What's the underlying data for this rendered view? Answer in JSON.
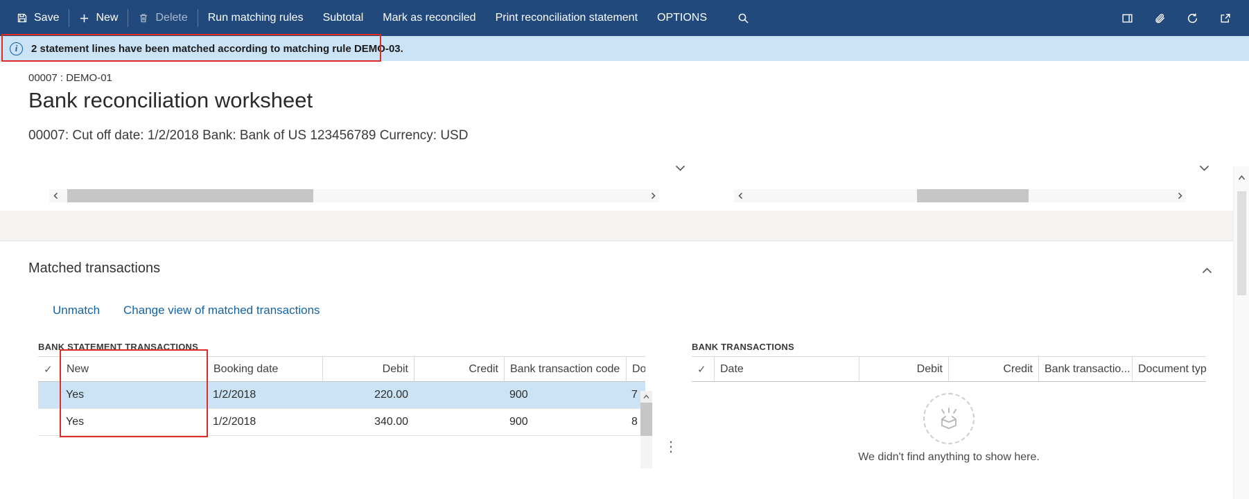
{
  "command_bar": {
    "items": [
      {
        "id": "save",
        "label": "Save"
      },
      {
        "id": "new",
        "label": "New"
      },
      {
        "id": "delete",
        "label": "Delete"
      },
      {
        "id": "run_matching_rules",
        "label": "Run matching rules"
      },
      {
        "id": "subtotal",
        "label": "Subtotal"
      },
      {
        "id": "mark_as_reconciled",
        "label": "Mark as reconciled"
      },
      {
        "id": "print_reconciliation_statement",
        "label": "Print reconciliation statement"
      },
      {
        "id": "options",
        "label": "OPTIONS"
      }
    ],
    "right_icons": [
      "side-panel-icon",
      "paperclip-icon",
      "refresh-icon",
      "popout-icon"
    ]
  },
  "message_bar": {
    "text": "2 statement lines have been matched according to matching rule DEMO-03."
  },
  "header": {
    "record_id": "00007 : DEMO-01",
    "title": "Bank reconciliation worksheet",
    "subtitle": "00007: Cut off date: 1/2/2018 Bank: Bank of US 123456789 Currency: USD"
  },
  "matched_section": {
    "title": "Matched transactions",
    "actions": {
      "unmatch": "Unmatch",
      "change_view": "Change view of matched transactions"
    },
    "left_table": {
      "caption": "BANK STATEMENT TRANSACTIONS",
      "columns": [
        "New",
        "Booking date",
        "Debit",
        "Credit",
        "Bank transaction code",
        "Docu"
      ],
      "rows": [
        {
          "selected": true,
          "new": "Yes",
          "booking_date": "1/2/2018",
          "debit": "220.00",
          "credit": "",
          "code": "900",
          "document": "7"
        },
        {
          "selected": false,
          "new": "Yes",
          "booking_date": "1/2/2018",
          "debit": "340.00",
          "credit": "",
          "code": "900",
          "document": "8"
        }
      ]
    },
    "right_table": {
      "caption": "BANK TRANSACTIONS",
      "columns": [
        "Date",
        "Debit",
        "Credit",
        "Bank transactio...",
        "Document type"
      ],
      "empty_state": {
        "text": "We didn't find anything to show here."
      }
    }
  },
  "icons": {
    "check": "✓",
    "info": "i",
    "ellipsis": "⋮"
  },
  "colors": {
    "command_bar_bg": "#21497c",
    "message_bar_bg": "#cbe3f6",
    "annotation_red": "#de2b23",
    "selected_row_bg": "#cbe3f5",
    "link": "#1464a5"
  }
}
